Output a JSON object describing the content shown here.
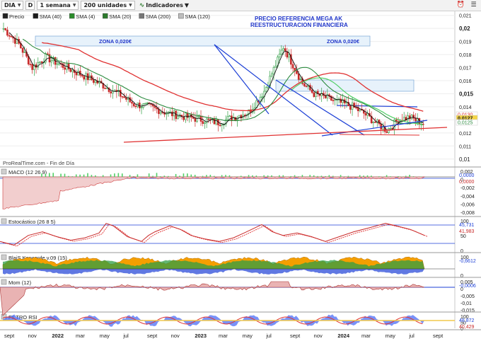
{
  "toolbar": {
    "instrument": "DIA",
    "period_code": "D",
    "timeframe": "1 semana",
    "units": "200 unidades",
    "indicators_label": "Indicadores"
  },
  "price_legend": [
    "Precio",
    "SMA (40)",
    "SMA (4)",
    "SMA (20)",
    "SMA (200)",
    "SMA (120)"
  ],
  "legend_colors": [
    "#222222",
    "#1a1a1a",
    "#2a8d2a",
    "#2b7a2b",
    "#777777",
    "#bdbdbd"
  ],
  "annotation": {
    "line1": "PRECIO REFERENCIA MEGA AK",
    "line2": "REESTRUCTURACION FINANCIERA"
  },
  "zones": {
    "left": "ZONA 0,020€",
    "right": "ZONA 0,020€"
  },
  "source": "ProRealTime.com - Fin de Día",
  "price_axis": [
    "0,021",
    "0,02",
    "0,019",
    "0,018",
    "0,017",
    "0,016",
    "0,015",
    "0,014",
    "0,013",
    "0,012",
    "0,011",
    "0,01"
  ],
  "price_badges": {
    "sma_a": "0,0130",
    "last": "0,0127",
    "sma_b": "0,0125"
  },
  "panels": {
    "macd": {
      "title": "MACD (12 26 9)",
      "axis": [
        "0,002",
        "0",
        "-0,002",
        "-0,004",
        "-0,006",
        "-0,008"
      ],
      "badges": [
        "0,0000",
        "0,0000"
      ]
    },
    "stoch": {
      "title": "Estocástico (26 8 5)",
      "axis": [
        "100",
        "50",
        "0"
      ],
      "badges": [
        "45,731",
        "41,983"
      ]
    },
    "koncorde": {
      "title": "BlaiS Koncorde v.09 (15)",
      "axis": [
        "100",
        "0"
      ],
      "badges": [
        "-0,6612"
      ]
    },
    "mom": {
      "title": "Mom (12)",
      "axis": [
        "0,005",
        "0",
        "-0,005",
        "-0,01",
        "-0,015"
      ],
      "badges": [
        "-0,0006"
      ]
    },
    "rsi": {
      "title": "FILTRO RSI",
      "axis": [
        "100",
        "50",
        "0"
      ],
      "badges": [
        "48,872",
        "40,429"
      ]
    }
  },
  "time_axis": [
    "sept",
    "nov",
    "2022",
    "mar",
    "may",
    "jul",
    "sept",
    "nov",
    "2023",
    "mar",
    "may",
    "jul",
    "sept",
    "nov",
    "2024",
    "mar",
    "may",
    "jul",
    "sept"
  ],
  "colors": {
    "up_candle": "#2f9e44",
    "down_candle": "#c92a2a",
    "sma_red": "#e03131",
    "sma_green": "#2b8a3e",
    "sma_light_green": "#51cf66",
    "trend_blue": "#1c3fd6",
    "trend_red": "#e03131",
    "zone_fill": "#e7f2fb",
    "annotation": "#1f35c9",
    "badge_last": "#f5d547"
  }
}
